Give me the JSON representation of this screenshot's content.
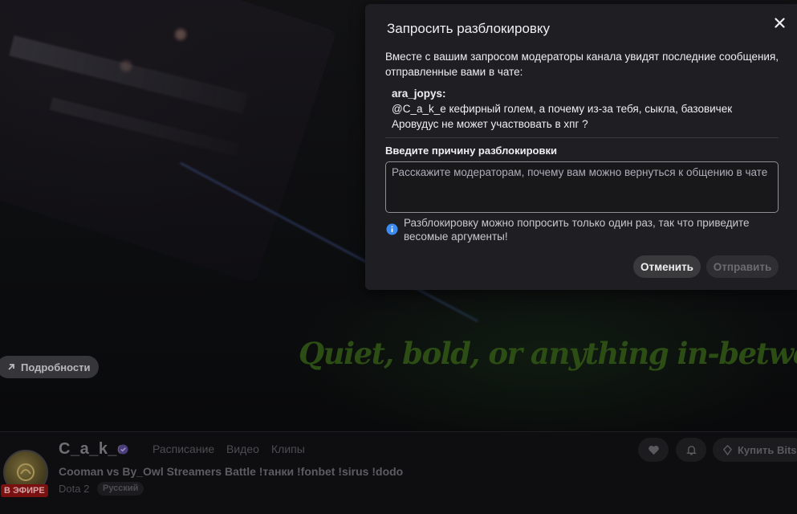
{
  "video": {
    "tagline": "Quiet, bold, or anything in-between.",
    "details_label": "Подробности"
  },
  "channel": {
    "name": "C_a_k_e",
    "live_label": "В ЭФИРЕ",
    "nav": [
      "Расписание",
      "Видео",
      "Клипы"
    ],
    "stream_title": "Cooman vs By_Owl Streamers Battle !танки !fonbet !sirus !dodo",
    "category": "Dota 2",
    "language": "Русский",
    "bits_label": "Купить Bits"
  },
  "modal": {
    "title": "Запросить разблокировку",
    "intro": "Вместе с вашим запросом модераторы канала увидят последние сообщения, отправленные вами в чате:",
    "message_user": "ara_jopys:",
    "message_text": "@C_a_k_e кефирный голем, а почему из-за тебя, сыкла, базовичек Аровудус не может участвовать в хпг ?",
    "reason_label": "Введите причину разблокировки",
    "reason_placeholder": "Расскажите модераторам, почему вам можно вернуться к общению в чате",
    "reason_value": "",
    "info": "Разблокировку можно попросить только один раз, так что приведите весомые аргументы!",
    "cancel_label": "Отменить",
    "send_label": "Отправить"
  },
  "icons": {
    "close": "close-icon",
    "info": "info-icon",
    "heart": "heart-icon",
    "bell": "bell-icon",
    "bits": "bits-icon",
    "arrow": "arrow-up-right-icon",
    "verified": "verified-badge-icon"
  },
  "colors": {
    "modal_bg": "#1f1f23",
    "info_blue": "#3c8cf0",
    "live_red": "#7a1010",
    "tagline_green": "#2c4d14"
  }
}
